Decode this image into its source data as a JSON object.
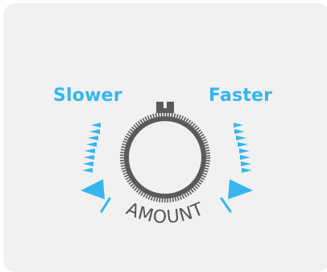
{
  "control": {
    "left_label": "Slower",
    "right_label": "Faster",
    "dial_caption": "AMOUNT"
  },
  "colors": {
    "background": "#f1f1f1",
    "accent": "#35b6f0",
    "knob": "#5a5a5a"
  },
  "icons": {
    "left_indicator": "triangle-left-icon",
    "right_indicator": "triangle-right-icon",
    "knob": "rotary-knob-icon"
  }
}
